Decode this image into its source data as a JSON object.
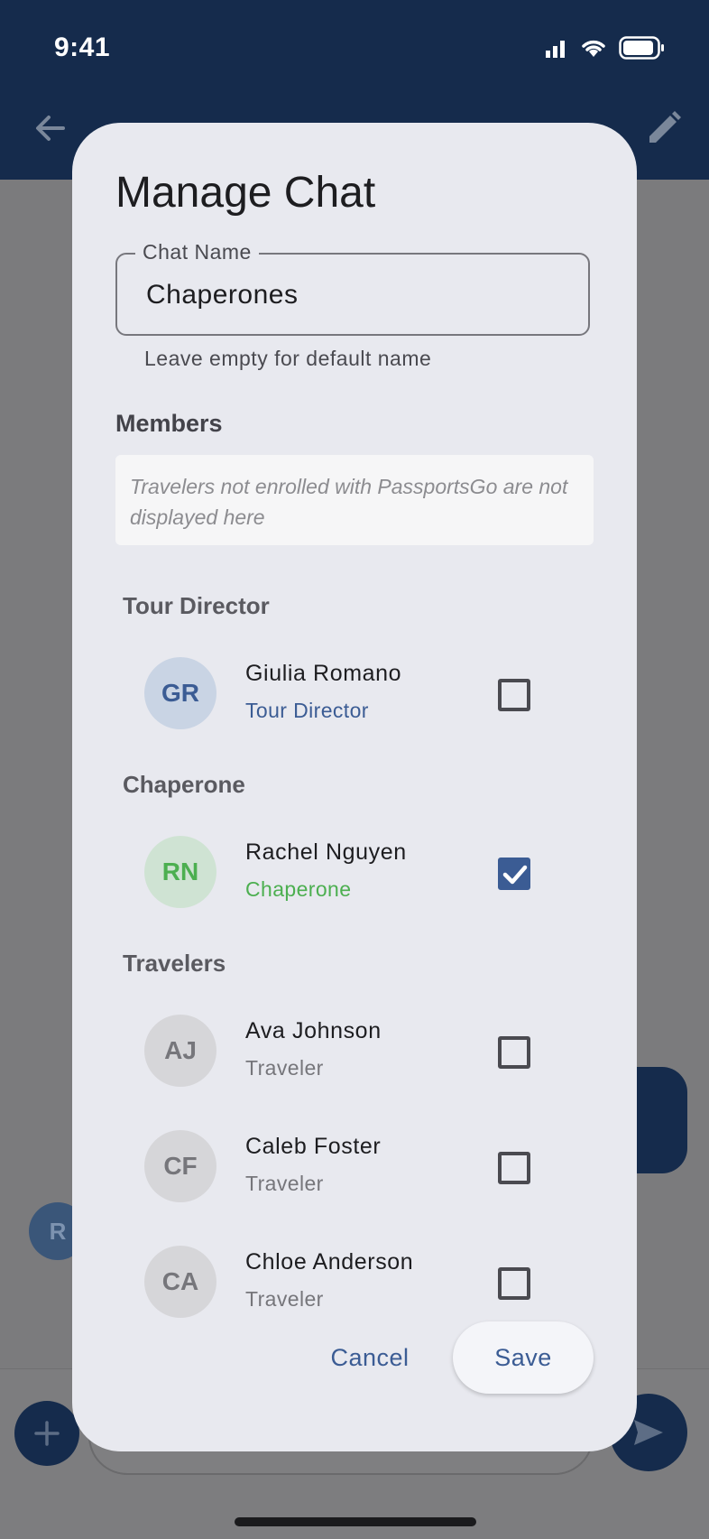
{
  "status_bar": {
    "time": "9:41"
  },
  "background": {
    "avatar_initial": "R"
  },
  "dialog": {
    "title": "Manage Chat",
    "chat_name": {
      "label": "Chat Name",
      "value": "Chaperones",
      "helper": "Leave empty for default name"
    },
    "members_title": "Members",
    "notice": "Travelers not enrolled with PassportsGo are not displayed here",
    "sections": [
      {
        "title": "Tour Director"
      },
      {
        "title": "Chaperone"
      },
      {
        "title": "Travelers"
      }
    ],
    "members": [
      {
        "initials": "GR",
        "name": "Giulia Romano",
        "role": "Tour Director",
        "checked": false,
        "avatar_bg": "#c9d4e4",
        "avatar_fg": "#3b5c94",
        "role_color": "#3b5c94"
      },
      {
        "initials": "RN",
        "name": "Rachel Nguyen",
        "role": "Chaperone",
        "checked": true,
        "avatar_bg": "#cfe3d3",
        "avatar_fg": "#4caf50",
        "role_color": "#4caf50"
      },
      {
        "initials": "AJ",
        "name": "Ava Johnson",
        "role": "Traveler",
        "checked": false,
        "avatar_bg": "#d6d6d9",
        "avatar_fg": "#76767b",
        "role_color": "#76767b"
      },
      {
        "initials": "CF",
        "name": "Caleb Foster",
        "role": "Traveler",
        "checked": false,
        "avatar_bg": "#d6d6d9",
        "avatar_fg": "#76767b",
        "role_color": "#76767b"
      },
      {
        "initials": "CA",
        "name": "Chloe Anderson",
        "role": "Traveler",
        "checked": false,
        "avatar_bg": "#d6d6d9",
        "avatar_fg": "#76767b",
        "role_color": "#76767b"
      }
    ],
    "cancel_label": "Cancel",
    "save_label": "Save"
  },
  "colors": {
    "primary": "#152b4c",
    "accent": "#3b5c94",
    "chaperone_green": "#4caf50"
  }
}
